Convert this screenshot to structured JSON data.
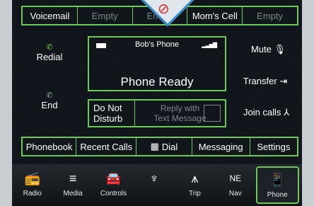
{
  "favorites": [
    "Voicemail",
    "Empty",
    "Empty",
    "Mom's Cell",
    "Empty"
  ],
  "left": {
    "redial": "Redial",
    "end": "End"
  },
  "right": {
    "mute": "Mute",
    "transfer": "Transfer",
    "join": "Join calls"
  },
  "status": {
    "device": "Bob's Phone",
    "text": "Phone Ready"
  },
  "dnd": {
    "label_line1": "Do Not",
    "label_line2": "Disturb",
    "reply_line1": "Reply with",
    "reply_line2": "Text Message"
  },
  "tabs": [
    "Phonebook",
    "Recent Calls",
    "Dial",
    "Messaging",
    "Settings"
  ],
  "nav": [
    "Radio",
    "Media",
    "Controls",
    "",
    "Trip",
    "Nav",
    "Phone"
  ],
  "nav_extra": {
    "ne": "NE"
  },
  "colors": {
    "accent": "#6fc85a",
    "background": "#0c1014",
    "bezel": "#c9ced3"
  }
}
